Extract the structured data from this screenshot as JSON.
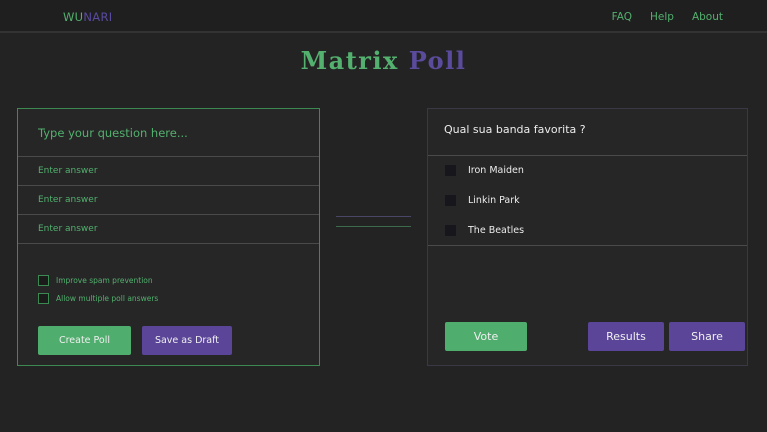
{
  "nav": {
    "brand_part1": "WU",
    "brand_part2": "NARI",
    "links": [
      "FAQ",
      "Help",
      "About"
    ]
  },
  "title": {
    "part1": "Matrix",
    "part2": "Poll"
  },
  "create_form": {
    "question_placeholder": "Type your question here...",
    "answer_placeholders": [
      "Enter answer",
      "Enter answer",
      "Enter answer"
    ],
    "options": [
      {
        "label": "Improve spam prevention",
        "checked": false
      },
      {
        "label": "Allow multiple poll answers",
        "checked": false
      }
    ],
    "create_label": "Create Poll",
    "draft_label": "Save as Draft"
  },
  "poll": {
    "question": "Qual sua banda favorita ?",
    "answers": [
      "Iron Maiden",
      "Linkin Park",
      "The Beatles"
    ],
    "vote_label": "Vote",
    "results_label": "Results",
    "share_label": "Share"
  },
  "colors": {
    "accent_green": "#53b06e",
    "accent_purple": "#5a4599",
    "background": "#232323"
  }
}
